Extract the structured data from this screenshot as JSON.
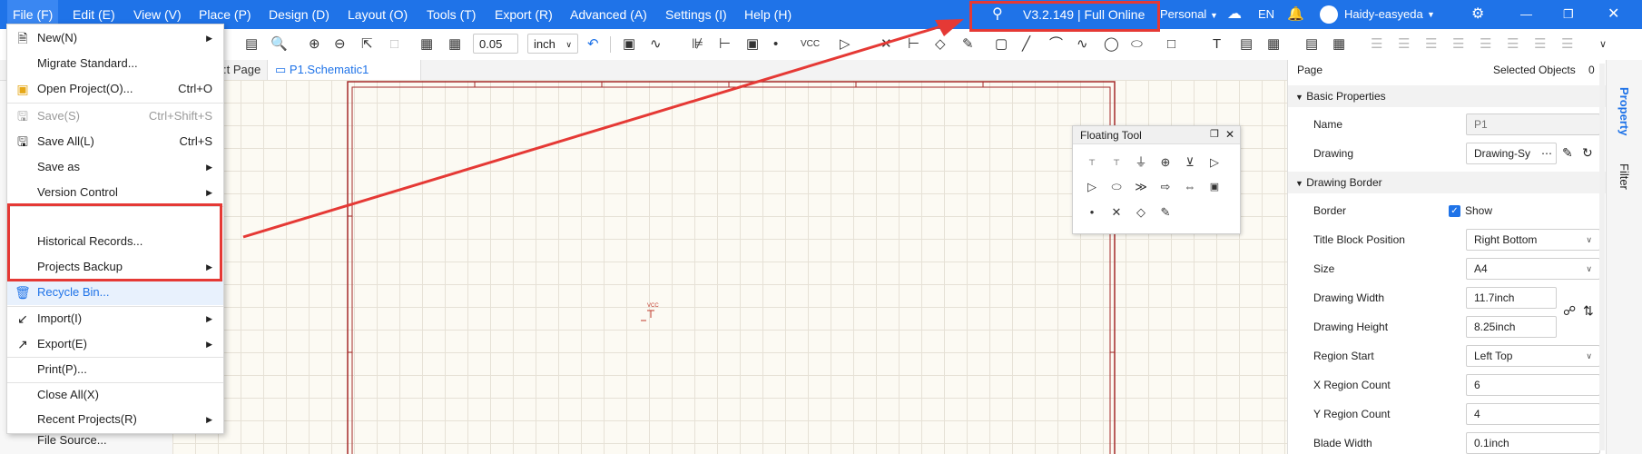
{
  "menubar": {
    "items": [
      "File (F)",
      "Edit (E)",
      "View (V)",
      "Place (P)",
      "Design (D)",
      "Layout (O)",
      "Tools (T)",
      "Export (R)",
      "Advanced (A)",
      "Settings (I)",
      "Help (H)"
    ],
    "version": "V3.2.149 | Full Online",
    "workspace": "Personal",
    "language": "EN",
    "username": "Haidy-easyeda"
  },
  "toolbar": {
    "grid_value": "0.05",
    "unit_value": "inch"
  },
  "tabs": [
    ":t Page",
    "P1.Schematic1"
  ],
  "file_menu": {
    "items": [
      {
        "label": "New(N)",
        "shortcut": "",
        "icon": "new-icon"
      },
      {
        "label": "Migrate Standard...",
        "shortcut": "",
        "icon": "none"
      },
      {
        "label": "Open Project(O)...",
        "shortcut": "Ctrl+O",
        "icon": "folder-icon"
      },
      {
        "label": "Save(S)",
        "shortcut": "Ctrl+Shift+S",
        "icon": "save-icon"
      },
      {
        "label": "Save All(L)",
        "shortcut": "Ctrl+S",
        "icon": "save-all-icon"
      },
      {
        "label": "Save as",
        "shortcut": "",
        "icon": "none"
      },
      {
        "label": "Version Control",
        "shortcut": "",
        "icon": "none"
      },
      {
        "label": "Historical Records...",
        "shortcut": "",
        "icon": "none"
      },
      {
        "label": "Projects Backup",
        "shortcut": "",
        "icon": "none"
      },
      {
        "label": "Recycle Bin...",
        "shortcut": "",
        "icon": "trash-icon"
      },
      {
        "label": "Import(I)",
        "shortcut": "",
        "icon": "import-icon"
      },
      {
        "label": "Export(E)",
        "shortcut": "",
        "icon": "export-icon"
      },
      {
        "label": "Print(P)...",
        "shortcut": "",
        "icon": "none"
      },
      {
        "label": "Close All(X)",
        "shortcut": "",
        "icon": "none"
      },
      {
        "label": "Recent Projects(R)",
        "shortcut": "",
        "icon": "none"
      },
      {
        "label": "File Source...",
        "shortcut": "",
        "icon": "none"
      }
    ]
  },
  "floating_tool": {
    "title": "Floating Tool"
  },
  "canvas": {
    "vcc_label": "VCC"
  },
  "right_panel": {
    "header_title": "Page",
    "selected_label": "Selected Objects",
    "selected_count": "0",
    "basic_section": "Basic Properties",
    "name_label": "Name",
    "name_placeholder": "P1",
    "drawing_label": "Drawing",
    "drawing_value": "Drawing-Sy",
    "border_section": "Drawing Border",
    "border_label": "Border",
    "show_label": "Show",
    "title_block_label": "Title Block Position",
    "title_block_value": "Right Bottom",
    "size_label": "Size",
    "size_value": "A4",
    "width_label": "Drawing Width",
    "width_value": "11.7inch",
    "height_label": "Drawing Height",
    "height_value": "8.25inch",
    "region_start_label": "Region Start",
    "region_start_value": "Left Top",
    "x_region_label": "X Region Count",
    "x_region_value": "6",
    "y_region_label": "Y Region Count",
    "y_region_value": "4",
    "blade_label": "Blade Width",
    "blade_value": "0.1inch"
  },
  "side_tabs": [
    "Property",
    "Filter"
  ],
  "colors": {
    "accent": "#1f73e8",
    "annotation": "#e53935",
    "border_red": "#a52a2a"
  }
}
